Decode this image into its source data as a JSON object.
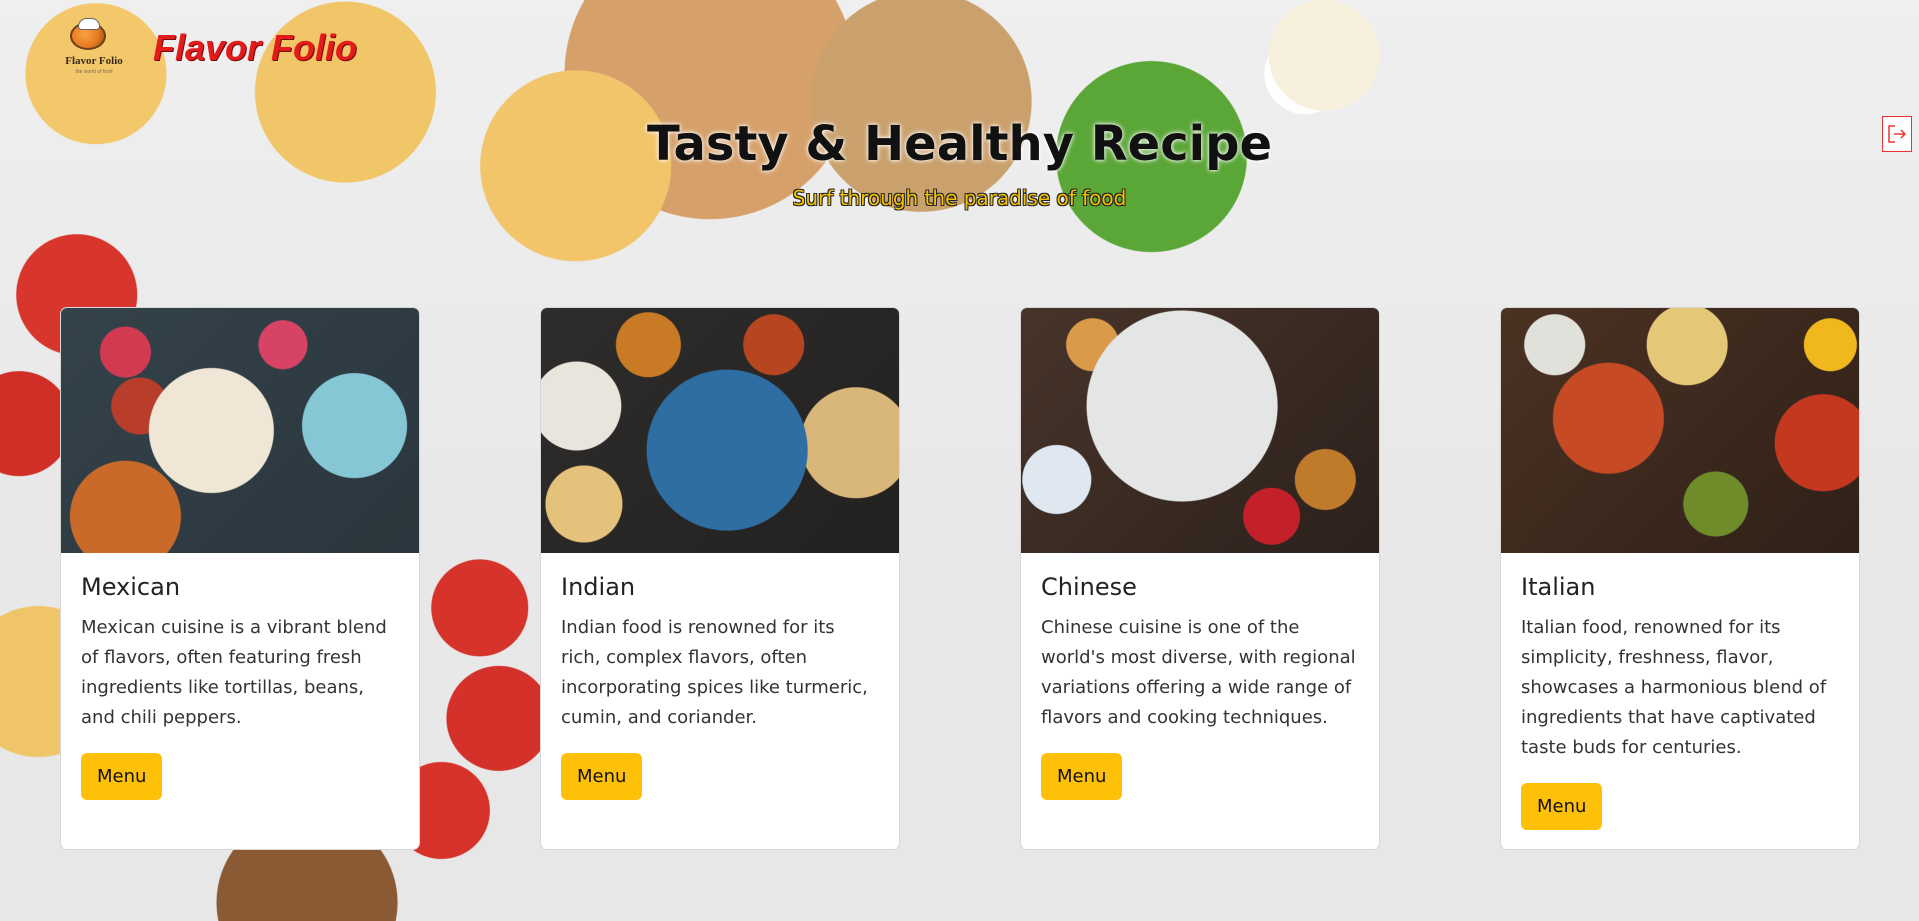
{
  "brand": {
    "logo_text": "Flavor Folio",
    "logo_tagline": "the world of food",
    "title": "Flavor Folio"
  },
  "hero": {
    "title": "Tasty & Healthy Recipe",
    "subtitle": "Surf through the paradise of food"
  },
  "header": {
    "logout_icon": "logout-icon"
  },
  "cards": [
    {
      "title": "Mexican",
      "text": "Mexican cuisine is a vibrant blend of flavors, often featuring fresh ingredients like tortillas, beans, and chili peppers.",
      "button": "Menu"
    },
    {
      "title": "Indian",
      "text": "Indian food is renowned for its rich, complex flavors, often incorporating spices like turmeric, cumin, and coriander.",
      "button": "Menu"
    },
    {
      "title": "Chinese",
      "text": "Chinese cuisine is one of the world's most diverse, with regional variations offering a wide range of flavors and cooking techniques.",
      "button": "Menu"
    },
    {
      "title": "Italian",
      "text": "Italian food, renowned for its simplicity, freshness, flavor, showcases a harmonious blend of ingredients that have captivated taste buds for centuries.",
      "button": "Menu"
    }
  ],
  "colors": {
    "brand": "#e31b1b",
    "subtitle": "#f2c100",
    "button": "#ffc107"
  }
}
